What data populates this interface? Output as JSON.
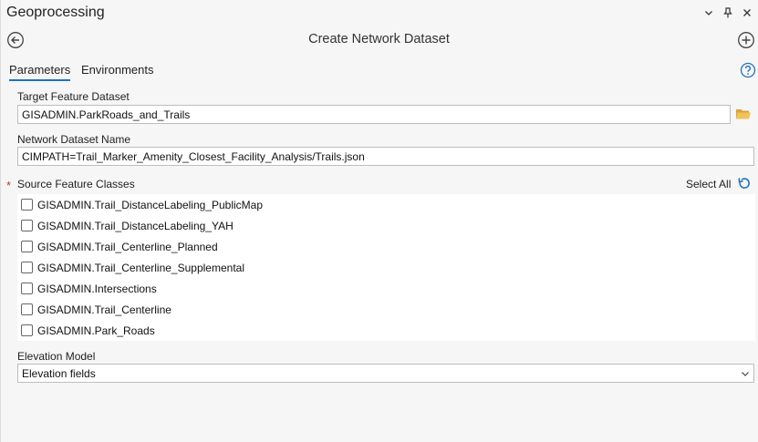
{
  "panel": {
    "title": "Geoprocessing"
  },
  "tool": {
    "title": "Create Network Dataset"
  },
  "tabs": [
    {
      "label": "Parameters",
      "active": true
    },
    {
      "label": "Environments",
      "active": false
    }
  ],
  "params": {
    "target_feature_dataset": {
      "label": "Target Feature Dataset",
      "value": "GISADMIN.ParkRoads_and_Trails"
    },
    "network_dataset_name": {
      "label": "Network Dataset Name",
      "value": "CIMPATH=Trail_Marker_Amenity_Closest_Facility_Analysis/Trails.json"
    },
    "source_feature_classes": {
      "required_marker": "*",
      "label": "Source Feature Classes",
      "select_all_label": "Select All",
      "items": [
        {
          "label": "GISADMIN.Trail_DistanceLabeling_PublicMap",
          "checked": false
        },
        {
          "label": "GISADMIN.Trail_DistanceLabeling_YAH",
          "checked": false
        },
        {
          "label": "GISADMIN.Trail_Centerline_Planned",
          "checked": false
        },
        {
          "label": "GISADMIN.Trail_Centerline_Supplemental",
          "checked": false
        },
        {
          "label": "GISADMIN.Intersections",
          "checked": false
        },
        {
          "label": "GISADMIN.Trail_Centerline",
          "checked": false
        },
        {
          "label": "GISADMIN.Park_Roads",
          "checked": false
        }
      ]
    },
    "elevation_model": {
      "label": "Elevation Model",
      "value": "Elevation fields"
    }
  },
  "colors": {
    "accent": "#1e73be",
    "folder": "#d9a43a",
    "required": "#c0392b"
  }
}
